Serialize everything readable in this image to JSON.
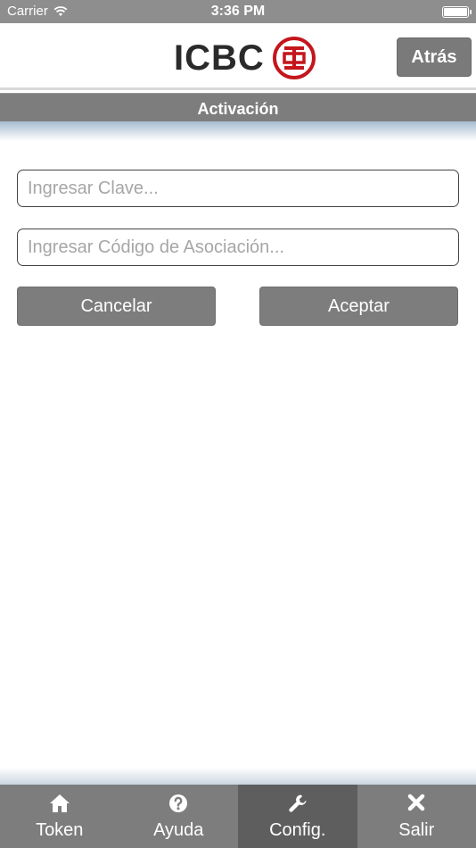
{
  "status_bar": {
    "carrier": "Carrier",
    "time": "3:36 PM"
  },
  "header": {
    "logo_text": "ICBC",
    "back_label": "Atrás"
  },
  "title": "Activación",
  "form": {
    "clave_placeholder": "Ingresar Clave...",
    "codigo_placeholder": "Ingresar Código de Asociación...",
    "cancel_label": "Cancelar",
    "accept_label": "Aceptar"
  },
  "tabs": [
    {
      "label": "Token",
      "icon": "home-icon"
    },
    {
      "label": "Ayuda",
      "icon": "help-icon"
    },
    {
      "label": "Config.",
      "icon": "wrench-icon",
      "active": true
    },
    {
      "label": "Salir",
      "icon": "close-icon"
    }
  ],
  "colors": {
    "brand_red": "#c4161c",
    "bar_gray": "#7d7d7d",
    "active_tab": "#5e5e5e"
  }
}
